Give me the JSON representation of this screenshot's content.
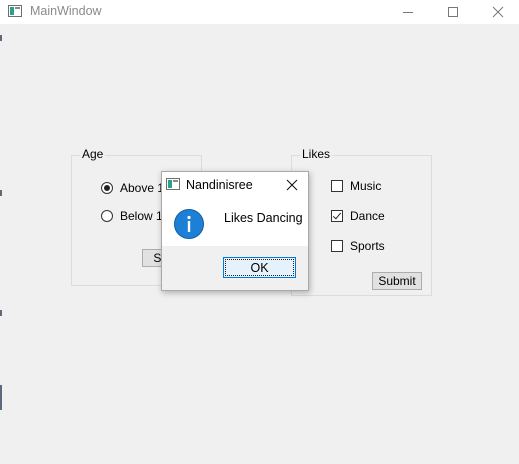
{
  "window": {
    "title": "MainWindow",
    "controls": {
      "minimize": "minimize",
      "maximize": "maximize",
      "close": "close"
    }
  },
  "age_group": {
    "title": "Age",
    "options": [
      {
        "label": "Above 18",
        "checked": true
      },
      {
        "label": "Below 18",
        "checked": false
      }
    ],
    "submit_label": "Submit"
  },
  "likes_group": {
    "title": "Likes",
    "options": [
      {
        "label": "Music",
        "checked": false
      },
      {
        "label": "Dance",
        "checked": true
      },
      {
        "label": "Sports",
        "checked": false
      }
    ],
    "submit_label": "Submit"
  },
  "dialog": {
    "title": "Nandinisree",
    "icon": "info-icon",
    "message": "Likes Dancing",
    "ok_label": "OK"
  },
  "colors": {
    "window_bg": "#f0f0f0",
    "info_icon": "#1e7fd6",
    "focus_border": "#0078d7"
  }
}
